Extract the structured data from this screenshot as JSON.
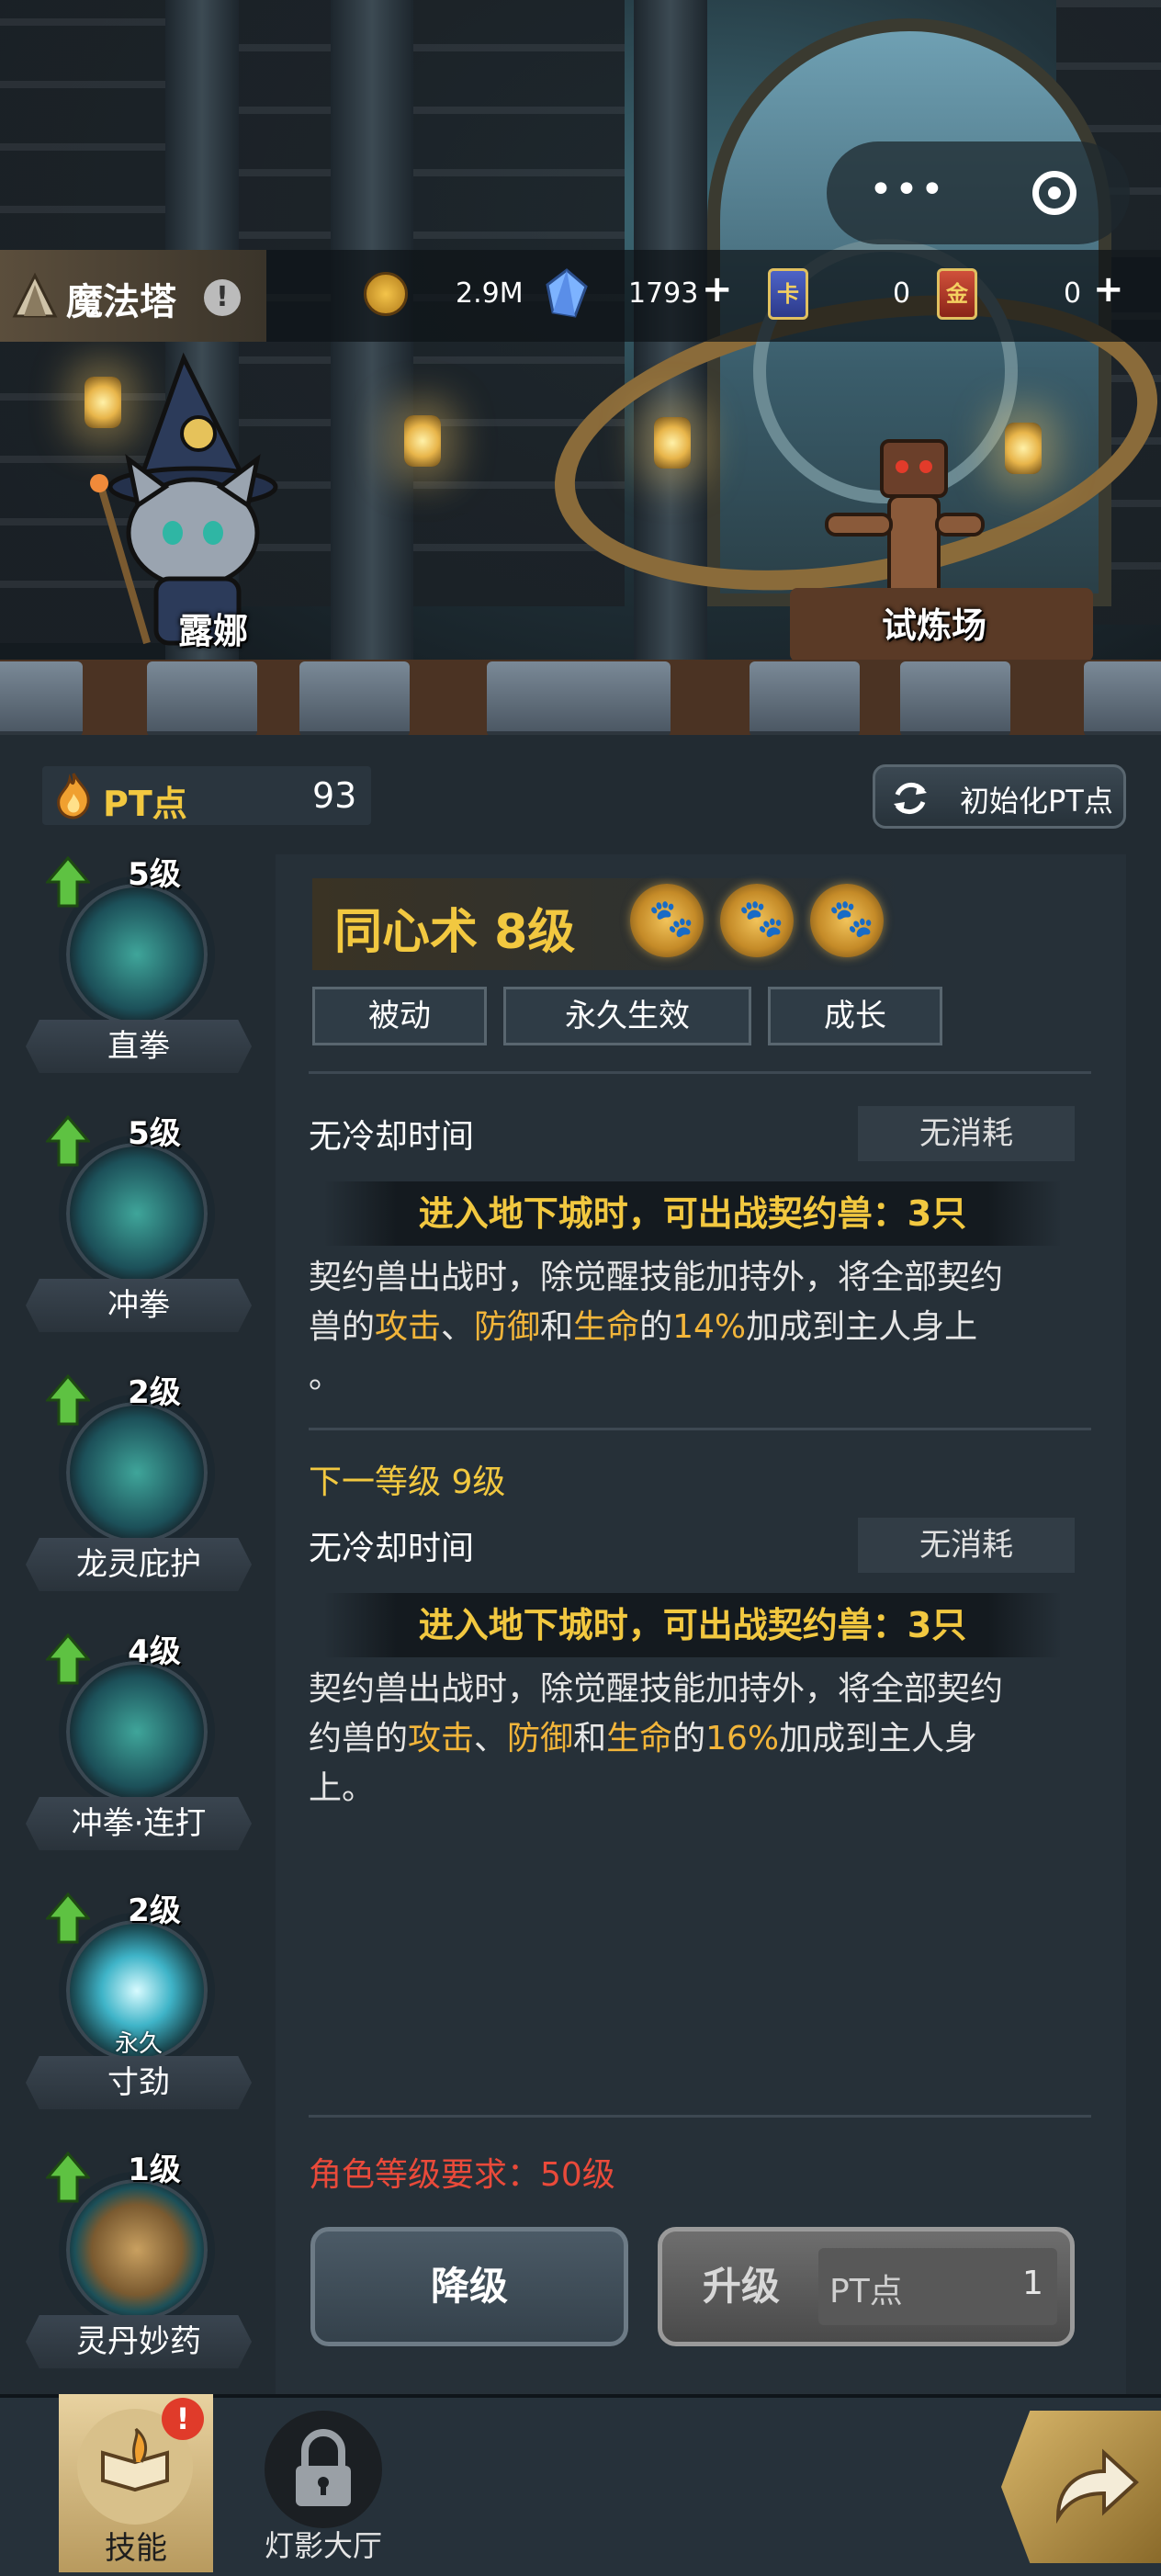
{
  "header": {
    "title": "魔法塔",
    "gold": "2.9M",
    "gems": "1793",
    "ticket_a": "0",
    "ticket_b": "0",
    "ticket_a_glyph": "卡",
    "ticket_b_glyph": "金"
  },
  "scene": {
    "npc_left": "露娜",
    "npc_right": "试炼场"
  },
  "pt": {
    "label": "PT点",
    "value": "93",
    "reset_label": "初始化PT点"
  },
  "skills": [
    {
      "level": "5级",
      "name": "直拳",
      "tag": ""
    },
    {
      "level": "5级",
      "name": "冲拳",
      "tag": ""
    },
    {
      "level": "2级",
      "name": "龙灵庇护",
      "tag": ""
    },
    {
      "level": "4级",
      "name": "冲拳·连打",
      "tag": ""
    },
    {
      "level": "2级",
      "name": "寸劲",
      "tag": "永久"
    },
    {
      "level": "1级",
      "name": "灵丹妙药",
      "tag": ""
    }
  ],
  "detail": {
    "title": "同心术 8级",
    "chips": [
      "被动",
      "永久生效",
      "成长"
    ],
    "cooldown": "无冷却时间",
    "cost": "无消耗",
    "banner": "进入地下城时，可出战契约兽：3只",
    "desc_line1": "契约兽出战时，除觉醒技能加持外，将全部契约",
    "desc_line2_a": "兽的",
    "desc_atk": "攻击",
    "desc_sep1": "、",
    "desc_def": "防御",
    "desc_and": "和",
    "desc_hp": "生命",
    "desc_of": "的",
    "desc_pct": "14%",
    "desc_tail": "加成到主人身上",
    "desc_line3": "。",
    "next_label": "下一等级 9级",
    "next_cooldown": "无冷却时间",
    "next_cost": "无消耗",
    "next_banner": "进入地下城时，可出战契约兽：3只",
    "next_line1": "契约兽出战时，除觉醒技能加持外，将全部契约",
    "next_line2_a": "约兽的",
    "next_atk": "攻击",
    "next_sep1": "、",
    "next_def": "防御",
    "next_and": "和",
    "next_hp": "生命",
    "next_of": "的",
    "next_pct": "16%",
    "next_tail": "加成到主人身",
    "next_line3": "上。",
    "requirement": "角色等级要求：50级",
    "downgrade": "降级",
    "upgrade": "升级",
    "cost_unit": "PT点",
    "cost_value": "1"
  },
  "nav": {
    "skills": "技能",
    "hall": "灯影大厅"
  },
  "colors": {
    "gold_text": "#f2c840",
    "highlight": "#f2b53a",
    "requirement_red": "#ea4a3a",
    "next_level_yellow": "#f2c840"
  }
}
